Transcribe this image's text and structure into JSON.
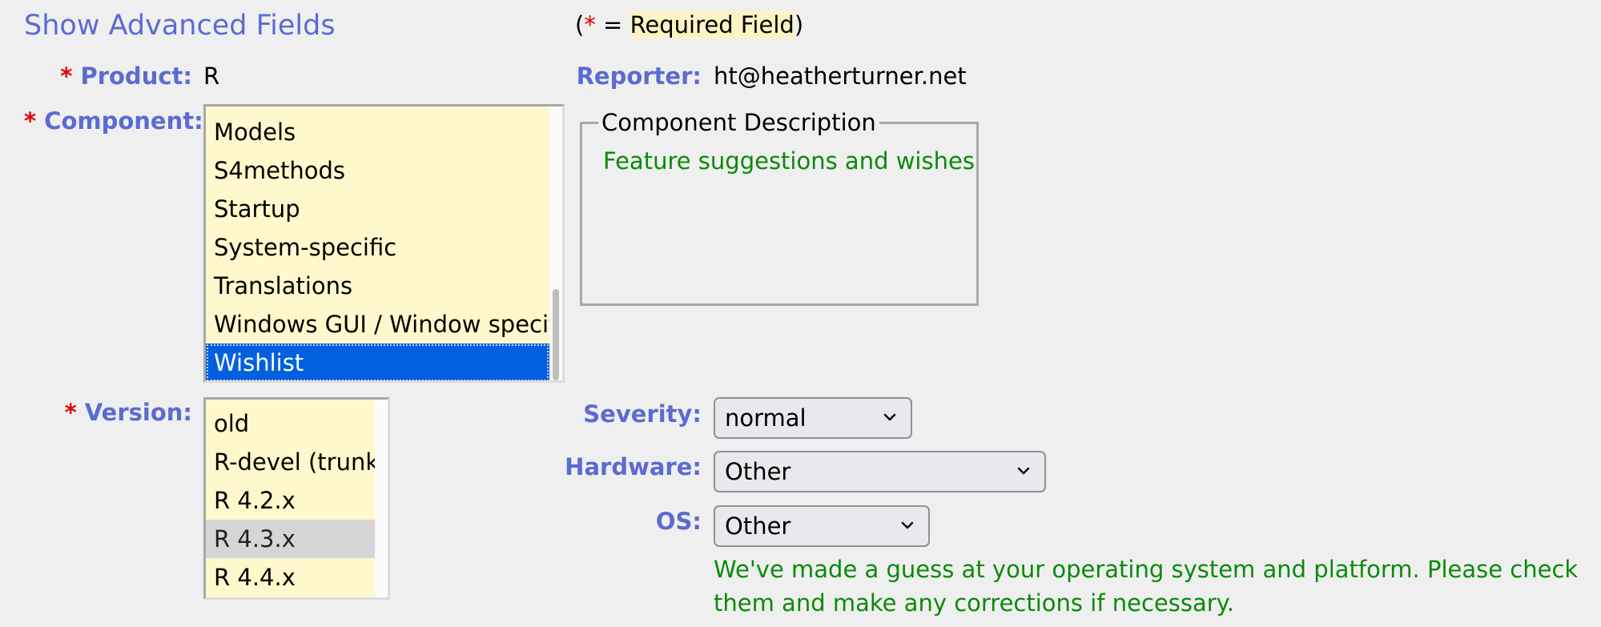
{
  "advanced_link": "Show Advanced Fields",
  "required_note": {
    "open": "(",
    "star": "*",
    "equals": " = ",
    "text": "Required Field",
    "close": ")"
  },
  "product": {
    "star": "*",
    "label": "Product:",
    "value": "R"
  },
  "reporter": {
    "label": "Reporter:",
    "value": "ht@heatherturner.net"
  },
  "component": {
    "star": "*",
    "label": "Component:",
    "options": [
      "Models",
      "S4methods",
      "Startup",
      "System-specific",
      "Translations",
      "Windows GUI / Window specific",
      "Wishlist"
    ],
    "selected": "Wishlist"
  },
  "component_description": {
    "legend": "Component Description",
    "text": "Feature suggestions and wishes"
  },
  "version": {
    "star": "*",
    "label": "Version:",
    "options": [
      "old",
      "R-devel (trunk)",
      "R 4.2.x",
      "R 4.3.x",
      "R 4.4.x"
    ],
    "selected": "R 4.3.x"
  },
  "severity": {
    "label": "Severity:",
    "value": "normal",
    "icon": "chevron-down-icon"
  },
  "hardware": {
    "label": "Hardware:",
    "value": "Other",
    "icon": "chevron-down-icon"
  },
  "os": {
    "label": "OS:",
    "value": "Other",
    "icon": "chevron-down-icon"
  },
  "guess_message": "We've made a guess at your operating system and platform. Please check them and make any corrections if necessary.",
  "colors": {
    "label": "#5b6bd1",
    "required_star": "#e00000",
    "info_green": "#0a8a0a",
    "selection_blue": "#0060df",
    "listbox_bg": "#fff8cc"
  }
}
